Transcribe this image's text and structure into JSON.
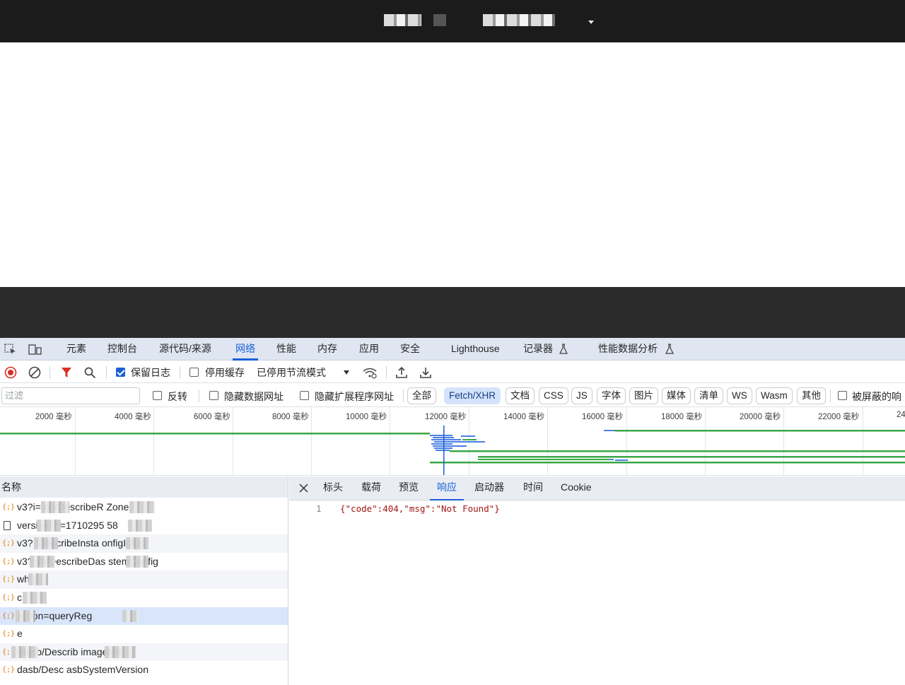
{
  "devtools": {
    "tabs": [
      "元素",
      "控制台",
      "源代码/来源",
      "网络",
      "性能",
      "内存",
      "应用",
      "安全",
      "Lighthouse",
      "记录器",
      "性能数据分析"
    ],
    "active_tab": "网络",
    "toolbar": {
      "preserve_log": "保留日志",
      "disable_cache": "停用缓存",
      "throttling": "已停用节流模式"
    },
    "filterbar": {
      "filter_placeholder": "过滤",
      "invert": "反转",
      "hide_data_urls": "隐藏数据网址",
      "hide_extension_urls": "隐藏扩展程序网址",
      "type_filters": [
        "全部",
        "Fetch/XHR",
        "文档",
        "CSS",
        "JS",
        "字体",
        "图片",
        "媒体",
        "清单",
        "WS",
        "Wasm",
        "其他"
      ],
      "active_type": "Fetch/XHR",
      "blocked_responses": "被屏蔽的响"
    },
    "timeline": {
      "ticks": [
        "2000 毫秒",
        "4000 毫秒",
        "6000 毫秒",
        "8000 毫秒",
        "10000 毫秒",
        "12000 毫秒",
        "14000 毫秒",
        "16000 毫秒",
        "18000 毫秒",
        "20000 毫秒",
        "22000 毫秒",
        "24"
      ]
    },
    "requests": {
      "header": "名称",
      "rows": [
        {
          "text": "v3?i=        on/DescribeR        Zone",
          "type": "xhr"
        },
        {
          "text": "versi        on?t=1710295          58",
          "type": "doc"
        },
        {
          "text": "v3?          /DescribeInsta      onfigInfos",
          "type": "xhr"
        },
        {
          "text": "v3?          sb/DescribeDas       stemConfig",
          "type": "xhr"
        },
        {
          "text": "wh       t",
          "type": "xhr"
        },
        {
          "text": "c",
          "type": "xhr"
        },
        {
          "text": "         action=queryReg",
          "type": "xhr"
        },
        {
          "text": "         e",
          "type": "xhr"
        },
        {
          "text": "         -dasb/Describ           imageIds",
          "type": "xhr"
        },
        {
          "text": "         dasb/Desc         asbSystemVersion",
          "type": "xhr"
        }
      ]
    },
    "detail": {
      "tabs": [
        "标头",
        "载荷",
        "预览",
        "响应",
        "启动器",
        "时间",
        "Cookie"
      ],
      "active_tab": "响应",
      "line_number": "1",
      "response_text": "{\"code\":404,\"msg\":\"Not Found\"}"
    }
  }
}
